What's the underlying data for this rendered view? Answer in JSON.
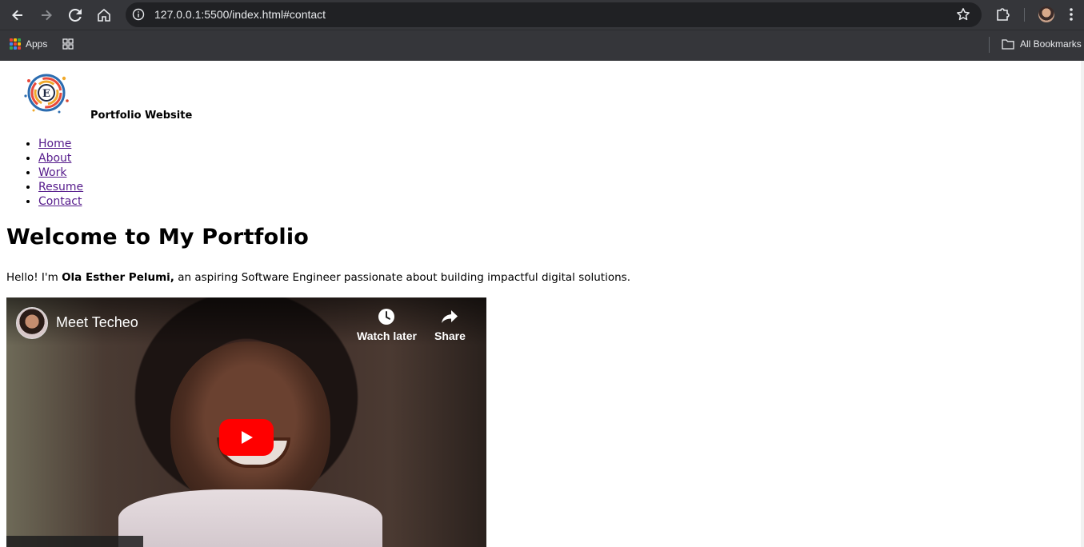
{
  "browser": {
    "url": "127.0.0.1:5500/index.html#contact",
    "bookmarks": {
      "apps_label": "Apps",
      "all_bookmarks_label": "All Bookmarks"
    }
  },
  "site": {
    "logo_letter": "E",
    "title": "Portfolio Website",
    "nav": [
      "Home",
      "About",
      "Work",
      "Resume",
      "Contact"
    ]
  },
  "hero": {
    "heading": "Welcome to My Portfolio",
    "intro_prefix": "Hello! I'm ",
    "intro_name": "Ola Esther Pelumi,",
    "intro_suffix": " an aspiring Software Engineer passionate about building impactful digital solutions."
  },
  "video": {
    "title": "Meet Techeo",
    "watch_later_label": "Watch later",
    "share_label": "Share"
  },
  "colors": {
    "chrome_bg": "#35363a",
    "omnibox_bg": "#202124",
    "link_visited": "#551a8b",
    "youtube_red": "#ff0000"
  }
}
